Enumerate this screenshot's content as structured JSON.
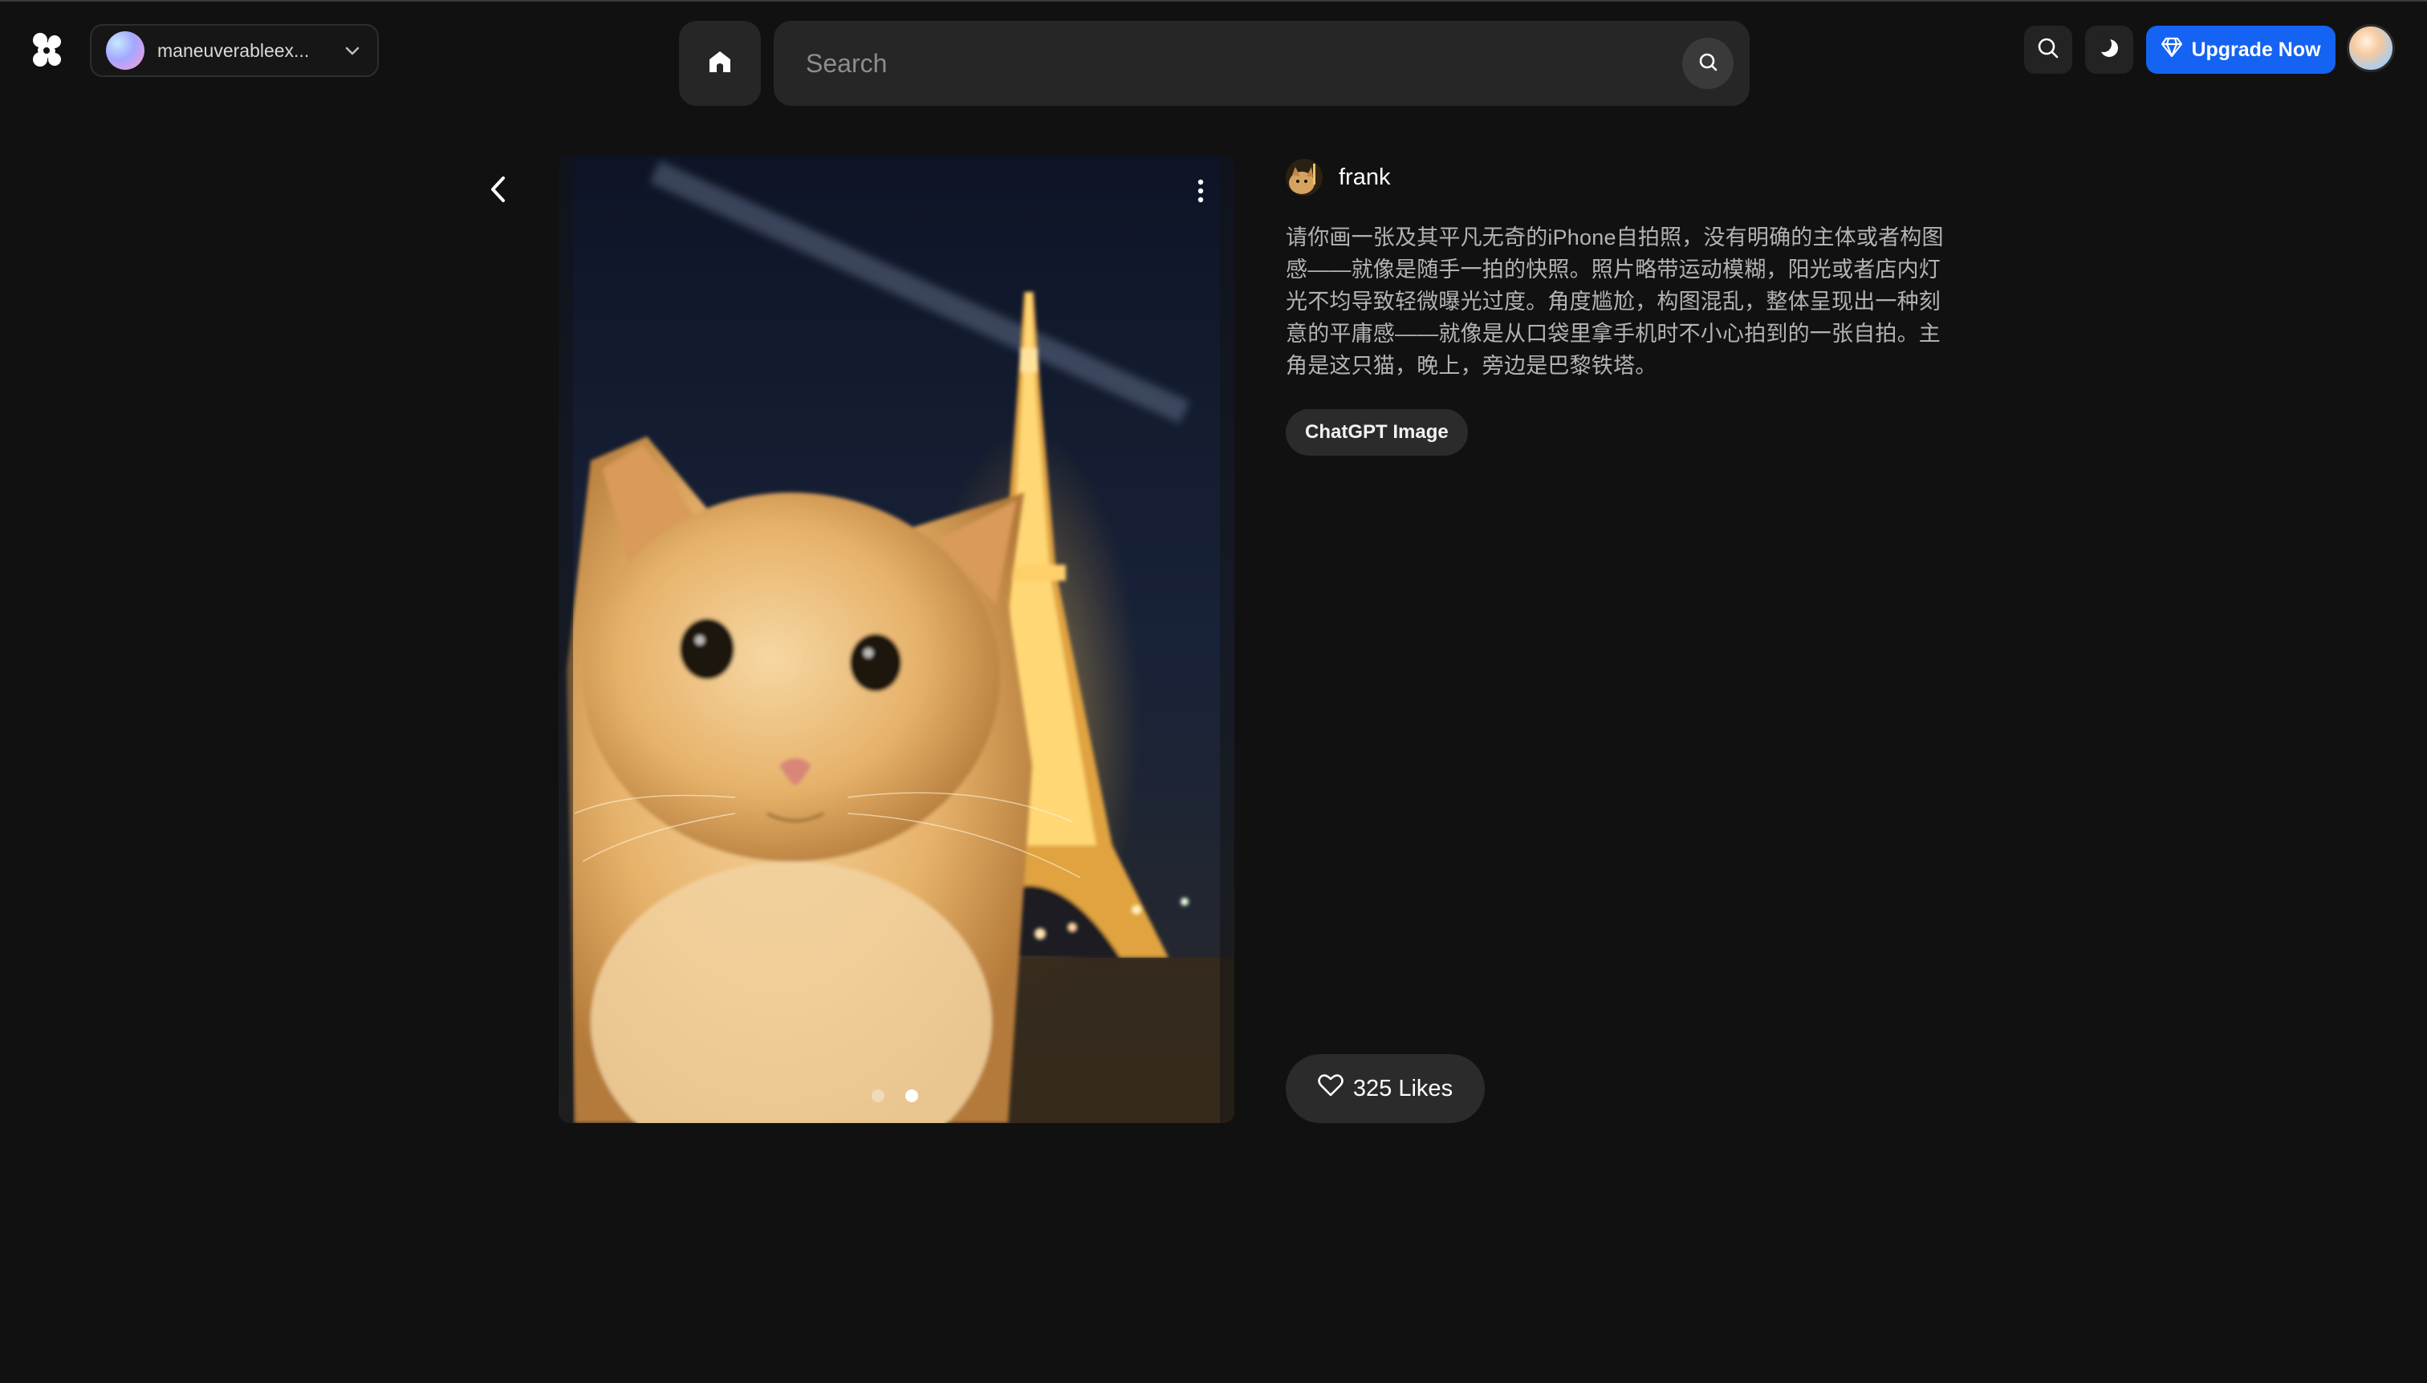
{
  "header": {
    "account_name": "maneuverableex...",
    "search_placeholder": "Search",
    "upgrade_label": "Upgrade Now"
  },
  "post": {
    "author": "frank",
    "prompt": "请你画一张及其平凡无奇的iPhone自拍照，没有明确的主体或者构图感——就像是随手一拍的快照。照片略带运动模糊，阳光或者店内灯光不均导致轻微曝光过度。角度尴尬，构图混乱，整体呈现出一种刻意的平庸感——就像是从口袋里拿手机时不小心拍到的一张自拍。主角是这只猫，晚上，旁边是巴黎铁塔。",
    "tag": "ChatGPT Image",
    "likes_label": "325 Likes",
    "image_count": 2,
    "active_image": 2
  },
  "icons": {
    "logo": "app-logo-icon",
    "home": "home-icon",
    "search": "search-icon",
    "theme": "moon-icon",
    "upgrade": "diamond-icon",
    "back": "chevron-left-icon",
    "more": "more-vertical-icon",
    "like": "heart-icon"
  },
  "colors": {
    "background": "#111111",
    "accent": "#1463f3",
    "surface": "#262626"
  }
}
